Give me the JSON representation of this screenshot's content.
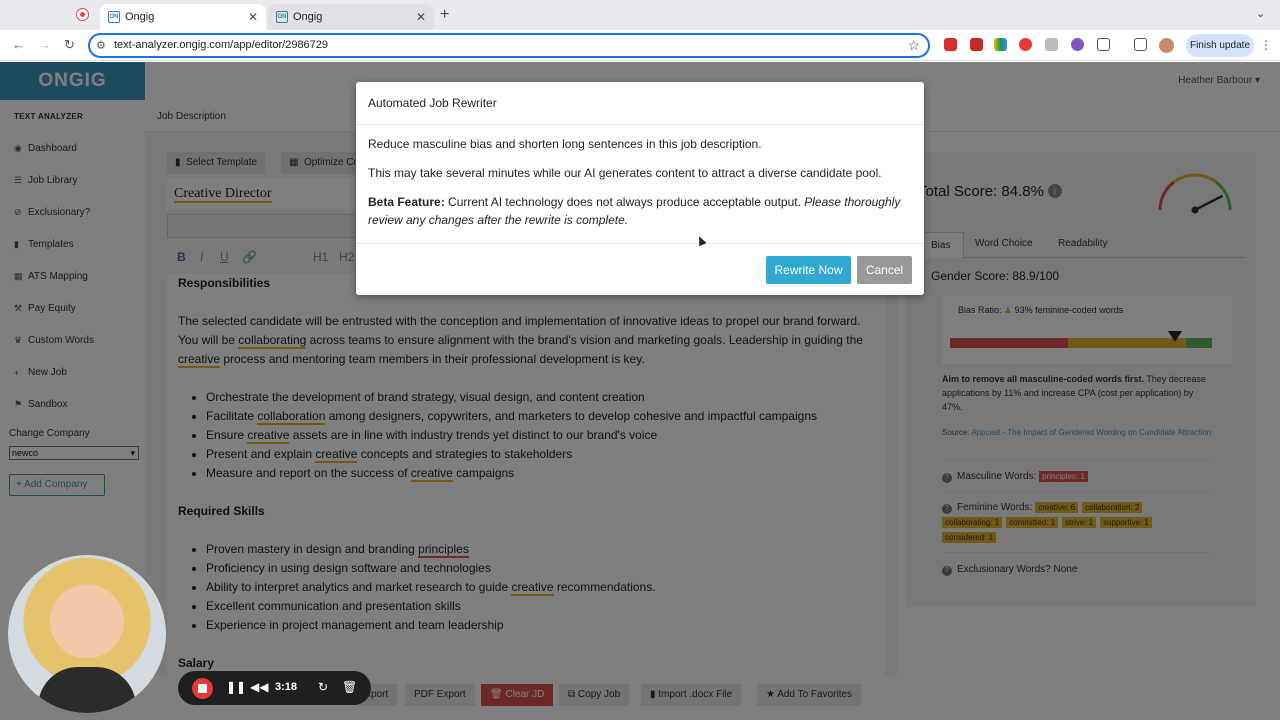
{
  "browser": {
    "tabs": [
      {
        "title": "Ongig",
        "favicon": "ON"
      },
      {
        "title": "Ongig",
        "favicon": "ON"
      }
    ],
    "url": "text-analyzer.ongig.com/app/editor/2986729",
    "finish_update": "Finish update"
  },
  "app": {
    "logo": "ONGIG",
    "user": "Heather Barbour",
    "page_header": "Job Description"
  },
  "sidebar": {
    "heading": "TEXT ANALYZER",
    "items": [
      {
        "label": "Dashboard",
        "icon": "dashboard-icon"
      },
      {
        "label": "Job Library",
        "icon": "list-icon"
      },
      {
        "label": "Exclusionary?",
        "icon": "ban-icon"
      },
      {
        "label": "Templates",
        "icon": "file-icon"
      },
      {
        "label": "ATS Mapping",
        "icon": "sitemap-icon"
      },
      {
        "label": "Pay Equity",
        "icon": "gavel-icon"
      },
      {
        "label": "Custom Words",
        "icon": "trophy-icon"
      },
      {
        "label": "New Job",
        "icon": "plus-icon"
      },
      {
        "label": "Sandbox",
        "icon": "sandbox-icon"
      }
    ],
    "change_company": "Change Company",
    "company_selected": "newco",
    "add_company": "+ Add Company"
  },
  "editor": {
    "select_template": "Select Template",
    "optimize": "Optimize Co",
    "job_title": "Creative Director",
    "heading_buttons": [
      "H1",
      "H2"
    ],
    "responsibilities_heading": "Responsibilities",
    "para": [
      "The selected candidate will be entrusted with the conception and implementation of innovative ideas to propel our brand forward. You will be ",
      "collaborating",
      " across teams to ensure alignment with the brand's vision and marketing goals. Leadership in guiding the ",
      "creative",
      " process and mentoring team members in their professional development is key."
    ],
    "bullets1": [
      [
        "Orchestrate the development of brand strategy, visual design, and content creation",
        "",
        ""
      ],
      [
        "Facilitate ",
        "collaboration",
        " among designers, copywriters, and marketers to develop cohesive and impactful campaigns"
      ],
      [
        "Ensure ",
        "creative",
        " assets are in line with industry trends yet distinct to our brand's voice"
      ],
      [
        "Present and explain ",
        "creative",
        " concepts and strategies to stakeholders"
      ],
      [
        "Measure and report on the success of ",
        "creative",
        " campaigns"
      ]
    ],
    "skills_heading": "Required Skills",
    "bullets2": [
      [
        "Proven mastery in design and branding ",
        "principles",
        "",
        "red"
      ],
      [
        "Proficiency in using design software and technologies",
        "",
        "",
        ""
      ],
      [
        "Ability to interpret analytics and market research to guide ",
        "creative",
        " recommendations.",
        "yel"
      ],
      [
        "Excellent communication and presentation skills",
        "",
        "",
        ""
      ],
      [
        "Experience in project management and team leadership",
        "",
        "",
        ""
      ]
    ],
    "salary_heading": "Salary",
    "bottom_buttons": [
      "xport",
      "PDF Export",
      "Clear JD",
      "Copy Job",
      "Import .docx File",
      "Add To Favorites"
    ]
  },
  "score": {
    "total": "Total Score: 84.8%",
    "gauge_value_pct": 84.8,
    "tabs": [
      "Bias",
      "Word Choice",
      "Readability"
    ],
    "gender_score": "Gender Score: 88.9/100",
    "bias_ratio": "Bias Ratio:",
    "bias_ratio_value": "93% feminine-coded words",
    "bias_marker_pct": 93,
    "aim_bold": "Aim to remove all masculine-coded words first.",
    "aim_rest": " They decrease applications by 11% and increase CPA (cost per application) by 47%.",
    "source_label": "Source: ",
    "source_link": "Appcast - The Impact of Gendered Wording on Candidate Attraction",
    "masculine_label": "Masculine Words:",
    "masculine_tags": [
      "principles: 1"
    ],
    "feminine_label": "Feminine Words:",
    "feminine_tags": [
      "creative: 6",
      "collaboration: 2",
      "collaborating: 1",
      "committed: 1",
      "strive: 1",
      "supportive: 1",
      "considered: 1"
    ],
    "exclusionary": "Exclusionary Words? None"
  },
  "modal": {
    "title": "Automated Job Rewriter",
    "line1": "Reduce masculine bias and shorten long sentences in this job description.",
    "line2": "This may take several minutes while our AI generates content to attract a diverse candidate pool.",
    "beta_label": "Beta Feature:",
    "beta_text": " Current AI technology does not always produce acceptable output. ",
    "beta_italic": "Please thoroughly review any changes after the rewrite is complete.",
    "rewrite_button": "Rewrite Now",
    "cancel_button": "Cancel"
  },
  "recorder": {
    "time": "3:18"
  },
  "colors": {
    "brand": "#3d97ba",
    "accent": "#2fa9d0",
    "feminine": "#e3b32f",
    "masculine": "#d9534f",
    "good": "#5cb85c"
  }
}
